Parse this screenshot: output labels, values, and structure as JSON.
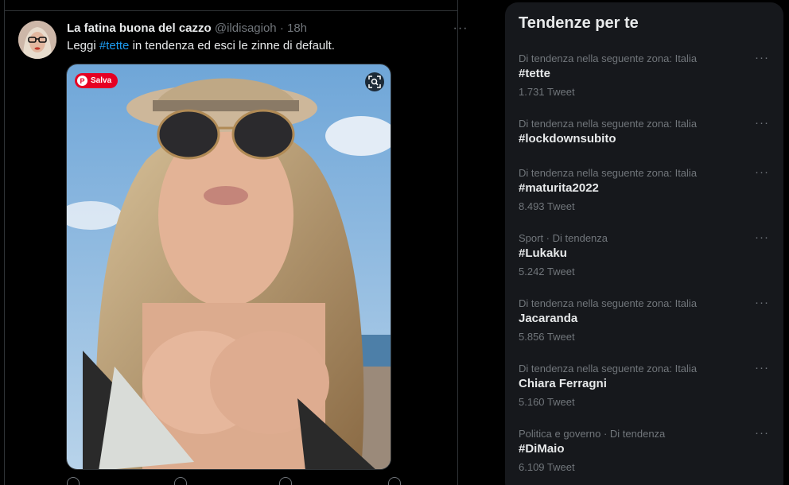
{
  "tweet": {
    "display_name": "La fatina buona del cazzo",
    "handle": "@ildisagioh",
    "separator": "·",
    "time": "18h",
    "more": "···",
    "text_before": "Leggi ",
    "hashtag": "#tette",
    "text_after": " in tendenza ed esci le zinne di default.",
    "media_save_label": "Salva",
    "media_pin_glyph": "P"
  },
  "sidebar": {
    "title": "Tendenze per te",
    "more": "···",
    "trends": [
      {
        "context": "Di tendenza nella seguente zona: Italia",
        "name": "#tette",
        "count": "1.731 Tweet"
      },
      {
        "context": "Di tendenza nella seguente zona: Italia",
        "name": "#lockdownsubito",
        "count": ""
      },
      {
        "context": "Di tendenza nella seguente zona: Italia",
        "name": "#maturita2022",
        "count": "8.493 Tweet"
      },
      {
        "context": "Sport · Di tendenza",
        "name": "#Lukaku",
        "count": "5.242 Tweet"
      },
      {
        "context": "Di tendenza nella seguente zona: Italia",
        "name": "Jacaranda",
        "count": "5.856 Tweet"
      },
      {
        "context": "Di tendenza nella seguente zona: Italia",
        "name": "Chiara Ferragni",
        "count": "5.160 Tweet"
      },
      {
        "context": "Politica e governo · Di tendenza",
        "name": "#DiMaio",
        "count": "6.109 Tweet"
      }
    ]
  },
  "icons": {
    "more": "more-horizontal-icon",
    "lens": "visual-search-icon",
    "pinterest": "pinterest-icon",
    "reply": "reply-icon",
    "retweet": "retweet-icon",
    "like": "like-icon",
    "share": "share-icon"
  },
  "colors": {
    "background": "#000000",
    "sidebar_bg": "#16181c",
    "text_primary": "#e7e9ea",
    "text_secondary": "#71767b",
    "link": "#1d9bf0",
    "pinterest_red": "#e60023"
  }
}
